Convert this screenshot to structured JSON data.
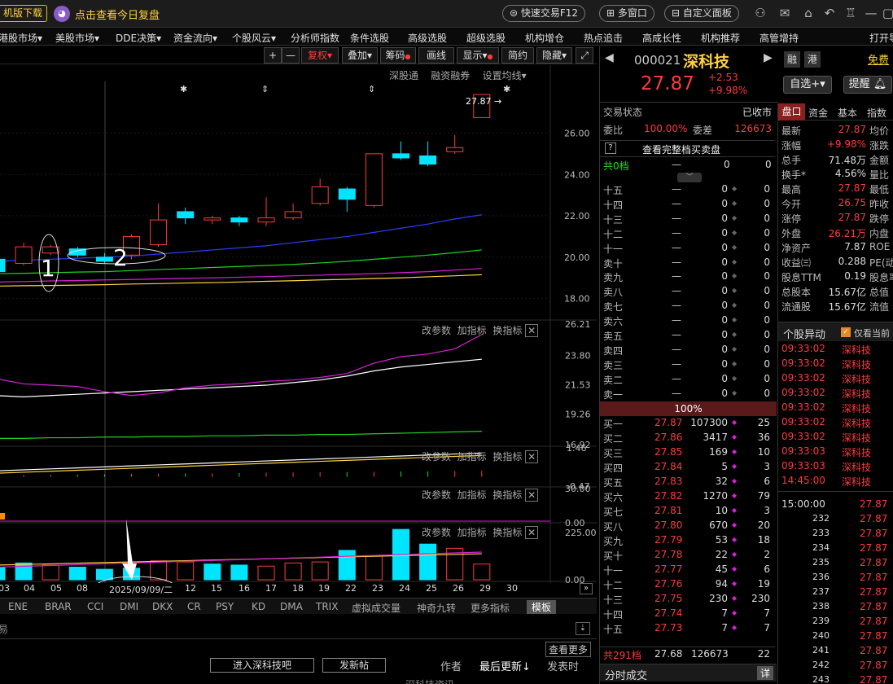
{
  "topbar": {
    "left_btn": "机版下载",
    "review_link": "点击查看今日复盘",
    "quick_trade": "快速交易F12",
    "multi_window": "多窗口",
    "custom_panel": "自定义面板"
  },
  "nav": [
    "港股市场",
    "美股市场",
    "DDE决策",
    "资金流向",
    "个股风云",
    "分析师指数",
    "条件选股",
    "高级选股",
    "超级选股",
    "机构增仓",
    "热点追击",
    "高成长性",
    "机构推荐",
    "高管增持",
    "打开导"
  ],
  "toolbar": {
    "plus": "+",
    "minus": "—",
    "restore": "复权",
    "overlay": "叠加",
    "chips": "筹码",
    "draw": "画线",
    "display": "显示",
    "brief": "简约",
    "hide": "隐藏"
  },
  "main_panel": {
    "links": [
      "深股通",
      "融资融券",
      "设置均线"
    ],
    "price_label": "27.87"
  },
  "panel_btns": {
    "params": "改参数",
    "add": "加指标",
    "switch": "换指标"
  },
  "annotations": {
    "one": "1",
    "two": "2"
  },
  "colors": {
    "up": "#ff3b3b",
    "down": "#00e5ff",
    "ma_blue": "#2a3cff",
    "ma_green": "#1fd21f",
    "ma_magenta": "#d81fd8",
    "ma_yellow": "#ffd23b",
    "bg": "#000000"
  },
  "chart_data": {
    "type": "candlestick",
    "x_labels": [
      "03",
      "04",
      "05",
      "08",
      "2025/09/09/二",
      "12",
      "15",
      "16",
      "17",
      "18",
      "19",
      "22",
      "23",
      "24",
      "25",
      "26",
      "29",
      "30"
    ],
    "price_ylim": [
      17,
      28.5
    ],
    "price_ticks": [
      "26.00",
      "24.00",
      "22.00",
      "20.00",
      "18.00"
    ],
    "candles": [
      {
        "o": 19.9,
        "c": 19.3,
        "h": 20.3,
        "l": 19.0
      },
      {
        "o": 19.7,
        "c": 20.5,
        "h": 20.7,
        "l": 19.6
      },
      {
        "o": 20.2,
        "c": 20.5,
        "h": 20.6,
        "l": 20.1
      },
      {
        "o": 20.4,
        "c": 20.1,
        "h": 20.5,
        "l": 20.0
      },
      {
        "o": 20.0,
        "c": 19.8,
        "h": 20.2,
        "l": 19.7
      },
      {
        "o": 20.1,
        "c": 21.0,
        "h": 21.1,
        "l": 19.9
      },
      {
        "o": 20.6,
        "c": 21.8,
        "h": 22.6,
        "l": 20.5
      },
      {
        "o": 22.2,
        "c": 21.9,
        "h": 22.4,
        "l": 21.6
      },
      {
        "o": 21.8,
        "c": 21.9,
        "h": 22.0,
        "l": 21.6
      },
      {
        "o": 21.9,
        "c": 21.7,
        "h": 22.0,
        "l": 21.5
      },
      {
        "o": 21.7,
        "c": 21.9,
        "h": 22.9,
        "l": 21.5
      },
      {
        "o": 21.9,
        "c": 22.2,
        "h": 22.6,
        "l": 21.8
      },
      {
        "o": 22.6,
        "c": 23.4,
        "h": 23.8,
        "l": 22.5
      },
      {
        "o": 23.3,
        "c": 22.8,
        "h": 23.4,
        "l": 22.2
      },
      {
        "o": 22.5,
        "c": 25.0,
        "h": 25.0,
        "l": 22.4
      },
      {
        "o": 25.0,
        "c": 24.8,
        "h": 25.6,
        "l": 24.7
      },
      {
        "o": 24.9,
        "c": 24.5,
        "h": 25.6,
        "l": 24.4
      },
      {
        "o": 25.1,
        "c": 25.3,
        "h": 25.9,
        "l": 25.0
      },
      {
        "o": 26.75,
        "c": 27.87,
        "h": 27.87,
        "l": 26.75
      }
    ],
    "ma_blue": [
      19.8,
      19.85,
      19.9,
      19.95,
      20.0,
      20.05,
      20.15,
      20.25,
      20.35,
      20.45,
      20.55,
      20.7,
      20.85,
      21.0,
      21.2,
      21.4,
      21.6,
      21.85,
      22.05
    ],
    "ma_green": [
      19.2,
      19.22,
      19.25,
      19.28,
      19.3,
      19.35,
      19.4,
      19.45,
      19.5,
      19.55,
      19.6,
      19.65,
      19.72,
      19.8,
      19.9,
      20.0,
      20.1,
      20.22,
      20.35
    ],
    "ma_magenta": [
      18.8,
      18.82,
      18.85,
      18.87,
      18.9,
      18.92,
      18.95,
      18.98,
      19.0,
      19.03,
      19.06,
      19.1,
      19.13,
      19.17,
      19.2,
      19.25,
      19.3,
      19.38,
      19.45
    ],
    "ma_yellow": [
      18.6,
      18.62,
      18.63,
      18.65,
      18.67,
      18.7,
      18.72,
      18.75,
      18.77,
      18.8,
      18.83,
      18.86,
      18.9,
      18.93,
      18.97,
      19.0,
      19.05,
      19.1,
      19.15
    ],
    "sub1_ticks": [
      "26.21",
      "23.80",
      "21.53",
      "19.26",
      "16.92"
    ],
    "sub1_magenta": [
      22.0,
      21.6,
      21.5,
      21.4,
      21.0,
      20.7,
      20.9,
      21.3,
      21.5,
      21.6,
      21.8,
      21.9,
      22.1,
      22.4,
      23.2,
      23.7,
      23.9,
      24.3,
      25.4
    ],
    "sub1_white": [
      20.7,
      20.6,
      20.7,
      20.8,
      20.9,
      21.0,
      21.1,
      21.2,
      21.3,
      21.4,
      21.5,
      21.7,
      21.9,
      22.2,
      22.6,
      22.9,
      23.1,
      23.3,
      23.5
    ],
    "sub1_green": [
      17.4,
      17.4,
      17.45,
      17.45,
      17.5,
      17.5,
      17.55,
      17.55,
      17.6,
      17.6,
      17.65,
      17.65,
      17.7,
      17.7,
      17.75,
      17.8,
      17.85,
      17.9,
      17.95
    ],
    "sub2_ticks": [
      "1.46",
      "-0.47"
    ],
    "sub3_ticks": [
      "30.00",
      "0.00"
    ],
    "volume_ticks": [
      "225.00",
      "0.00"
    ],
    "volume": [
      60,
      80,
      70,
      60,
      50,
      55,
      90,
      85,
      75,
      70,
      65,
      80,
      85,
      140,
      115,
      240,
      170,
      150,
      75
    ],
    "volume_up": [
      false,
      false,
      true,
      false,
      false,
      false,
      true,
      true,
      false,
      false,
      true,
      true,
      true,
      false,
      true,
      false,
      false,
      true,
      true
    ]
  },
  "indicator_tabs": [
    "ENE",
    "BRAR",
    "CCI",
    "DMI",
    "DKX",
    "CR",
    "PSY",
    "KD",
    "DMA",
    "TRIX",
    "虚拟成交量",
    "神奇九转",
    "更多指标",
    "模板"
  ],
  "bottom": {
    "view_more": "查看更多",
    "forum": "进入深科技吧",
    "post": "发新帖",
    "author": "作者",
    "latest": "最后更新↓",
    "post_time": "发表时",
    "row": "深科技资讯"
  },
  "quote": {
    "code": "000021",
    "name": "深科技",
    "price": "27.87",
    "change": "+2.53",
    "pct": "+9.98%",
    "rong": "融",
    "gang": "港",
    "free": "免费",
    "watch": "自选+",
    "alert": "提醒",
    "status_label": "交易状态",
    "status": "已收市",
    "wb_label": "委比",
    "wb": "100.00%",
    "wc_label": "委差",
    "wc": "126673",
    "full_depth": "查看完整档买卖盘",
    "total_sell": "共0档",
    "total_buy": "共291档",
    "total_buy_price": "27.68",
    "total_buy_vol": "126673",
    "total_buy_n": "22",
    "mid_pct": "100%",
    "tick_title": "分时成交",
    "tick_detail": "详"
  },
  "sells": [
    {
      "label": "十五",
      "price": "—",
      "vol": "0",
      "n": "0"
    },
    {
      "label": "十四",
      "price": "—",
      "vol": "0",
      "n": "0"
    },
    {
      "label": "十三",
      "price": "—",
      "vol": "0",
      "n": "0"
    },
    {
      "label": "十二",
      "price": "—",
      "vol": "0",
      "n": "0"
    },
    {
      "label": "十一",
      "price": "—",
      "vol": "0",
      "n": "0"
    },
    {
      "label": "卖十",
      "price": "—",
      "vol": "0",
      "n": "0"
    },
    {
      "label": "卖九",
      "price": "—",
      "vol": "0",
      "n": "0"
    },
    {
      "label": "卖八",
      "price": "—",
      "vol": "0",
      "n": "0"
    },
    {
      "label": "卖七",
      "price": "—",
      "vol": "0",
      "n": "0"
    },
    {
      "label": "卖六",
      "price": "—",
      "vol": "0",
      "n": "0"
    },
    {
      "label": "卖五",
      "price": "—",
      "vol": "0",
      "n": "0"
    },
    {
      "label": "卖四",
      "price": "—",
      "vol": "0",
      "n": "0"
    },
    {
      "label": "卖三",
      "price": "—",
      "vol": "0",
      "n": "0"
    },
    {
      "label": "卖二",
      "price": "—",
      "vol": "0",
      "n": "0"
    },
    {
      "label": "卖一",
      "price": "—",
      "vol": "0",
      "n": "0"
    }
  ],
  "buys": [
    {
      "label": "买一",
      "price": "27.87",
      "vol": "107300",
      "n": "25"
    },
    {
      "label": "买二",
      "price": "27.86",
      "vol": "3417",
      "n": "36"
    },
    {
      "label": "买三",
      "price": "27.85",
      "vol": "169",
      "n": "10"
    },
    {
      "label": "买四",
      "price": "27.84",
      "vol": "5",
      "n": "3"
    },
    {
      "label": "买五",
      "price": "27.83",
      "vol": "32",
      "n": "6"
    },
    {
      "label": "买六",
      "price": "27.82",
      "vol": "1270",
      "n": "79"
    },
    {
      "label": "买七",
      "price": "27.81",
      "vol": "10",
      "n": "3"
    },
    {
      "label": "买八",
      "price": "27.80",
      "vol": "670",
      "n": "20"
    },
    {
      "label": "买九",
      "price": "27.79",
      "vol": "53",
      "n": "18"
    },
    {
      "label": "买十",
      "price": "27.78",
      "vol": "22",
      "n": "2"
    },
    {
      "label": "十一",
      "price": "27.77",
      "vol": "45",
      "n": "6"
    },
    {
      "label": "十二",
      "price": "27.76",
      "vol": "94",
      "n": "19"
    },
    {
      "label": "十三",
      "price": "27.75",
      "vol": "230",
      "n": "230"
    },
    {
      "label": "十四",
      "price": "27.74",
      "vol": "7",
      "n": "7"
    },
    {
      "label": "十五",
      "price": "27.73",
      "vol": "7",
      "n": "7"
    }
  ],
  "rtabs": [
    "盘口",
    "资金",
    "基本",
    "指数"
  ],
  "stats": [
    {
      "k": "最新",
      "v": "27.87",
      "t": "均价"
    },
    {
      "k": "涨幅",
      "v": "+9.98%",
      "t": "涨跌"
    },
    {
      "k": "总手",
      "v": "71.48万",
      "t": "金额"
    },
    {
      "k": "换手*",
      "v": "4.56%",
      "t": "量比"
    },
    {
      "k": "最高",
      "v": "27.87",
      "t": "最低"
    },
    {
      "k": "今开",
      "v": "26.75",
      "t": "昨收"
    },
    {
      "k": "涨停",
      "v": "27.87",
      "t": "跌停"
    },
    {
      "k": "外盘",
      "v": "26.21万",
      "t": "内盘"
    },
    {
      "k": "净资产",
      "v": "7.87",
      "t": "ROE"
    },
    {
      "k": "收益㈢",
      "v": "0.288",
      "t": "PE(动"
    },
    {
      "k": "股息TTM",
      "v": "0.19",
      "t": "股息率"
    },
    {
      "k": "总股本",
      "v": "15.67亿",
      "t": "总值"
    },
    {
      "k": "流通股",
      "v": "15.67亿",
      "t": "流值"
    }
  ],
  "anomaly": {
    "title": "个股异动",
    "only_current": "仅看当前"
  },
  "anomaly_rows": [
    {
      "time": "09:33:02",
      "name": "深科技"
    },
    {
      "time": "09:33:02",
      "name": "深科技"
    },
    {
      "time": "09:33:02",
      "name": "深科技"
    },
    {
      "time": "09:33:02",
      "name": "深科技"
    },
    {
      "time": "09:33:02",
      "name": "深科技"
    },
    {
      "time": "09:33:02",
      "name": "深科技"
    },
    {
      "time": "09:33:02",
      "name": "深科技"
    },
    {
      "time": "09:33:03",
      "name": "深科技"
    },
    {
      "time": "09:33:03",
      "name": "深科技"
    },
    {
      "time": "14:45:00",
      "name": "深科技"
    }
  ],
  "ticks_header": {
    "time": "15:00:00",
    "price": "27.87"
  },
  "ticks": [
    {
      "n": "232",
      "p": "27.87"
    },
    {
      "n": "233",
      "p": "27.87"
    },
    {
      "n": "234",
      "p": "27.87"
    },
    {
      "n": "235",
      "p": "27.87"
    },
    {
      "n": "236",
      "p": "27.87"
    },
    {
      "n": "237",
      "p": "27.87"
    },
    {
      "n": "238",
      "p": "27.87"
    },
    {
      "n": "239",
      "p": "27.87"
    },
    {
      "n": "240",
      "p": "27.87"
    },
    {
      "n": "241",
      "p": "27.87"
    },
    {
      "n": "242",
      "p": "27.87"
    },
    {
      "n": "243",
      "p": "27.87"
    }
  ]
}
